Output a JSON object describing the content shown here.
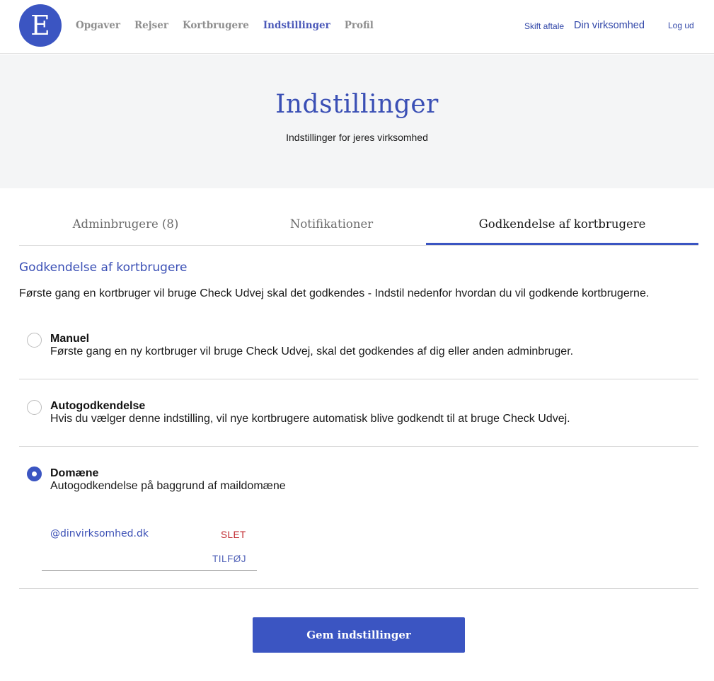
{
  "header": {
    "logo_letter": "E",
    "nav": [
      "Opgaver",
      "Rejser",
      "Kortbrugere",
      "Indstillinger",
      "Profil"
    ],
    "active_nav": "Indstillinger",
    "switch_agreement": "Skift aftale",
    "company": "Din virksomhed",
    "logout": "Log ud"
  },
  "hero": {
    "title": "Indstillinger",
    "subtitle": "Indstillinger for jeres virksomhed"
  },
  "tabs": [
    "Adminbrugere (8)",
    "Notifikationer",
    "Godkendelse af kortbrugere"
  ],
  "active_tab": "Godkendelse af kortbrugere",
  "section": {
    "title": "Godkendelse af kortbrugere",
    "description": "Første gang en kortbruger vil bruge Check Udvej skal det godkendes - Indstil nedenfor hvordan du vil godkende kortbrugerne."
  },
  "options": [
    {
      "title": "Manuel",
      "description": "Første gang en ny kortbruger vil bruge Check Udvej, skal det godkendes af dig eller anden adminbruger.",
      "selected": false
    },
    {
      "title": "Autogodkendelse",
      "description": "Hvis du vælger denne indstilling, vil nye kortbrugere automatisk blive godkendt til at bruge Check Udvej.",
      "selected": false
    },
    {
      "title": "Domæne",
      "description": "Autogodkendelse på baggrund af maildomæne",
      "selected": true
    }
  ],
  "domains": {
    "items": [
      "@dinvirksomhed.dk"
    ],
    "delete_label": "SLET",
    "add_label": "TILFØJ",
    "input_value": ""
  },
  "save_button": "Gem indstillinger",
  "colors": {
    "primary": "#3b55c2",
    "delete": "#c0272d",
    "hero_bg": "#f4f5f6"
  }
}
